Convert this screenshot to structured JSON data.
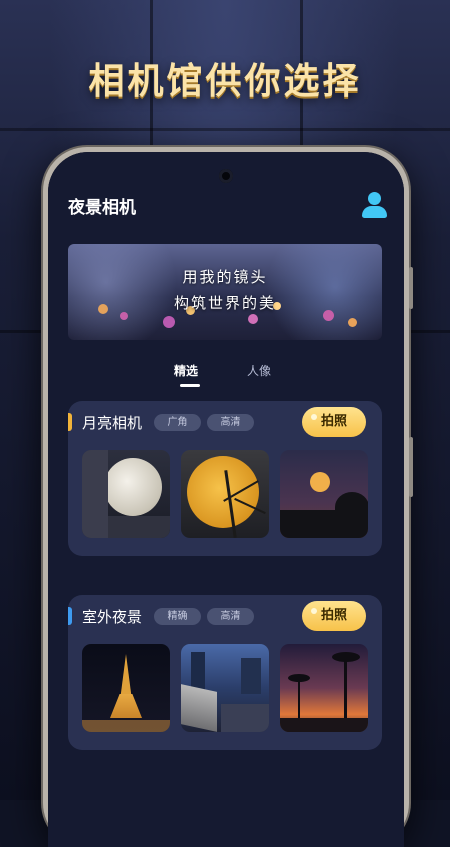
{
  "headline": "相机馆供你选择",
  "app": {
    "title": "夜景相机",
    "profile_icon": "user-profile-icon"
  },
  "banner": {
    "line1": "用我的镜头",
    "line2": "构筑世界的美"
  },
  "tabs": [
    {
      "label": "精选",
      "active": true
    },
    {
      "label": "人像",
      "active": false
    }
  ],
  "cards": [
    {
      "title": "月亮相机",
      "accent": "#f2b43a",
      "tags": [
        "广角",
        "高清"
      ],
      "action_label": "拍照",
      "thumbnails": [
        "moon-over-building",
        "full-moon-tree-silhouette",
        "moon-over-trees-dusk"
      ]
    },
    {
      "title": "室外夜景",
      "accent": "#3e9bf0",
      "tags": [
        "精确",
        "高清"
      ],
      "action_label": "拍照",
      "thumbnails": [
        "eiffel-tower-night",
        "city-train-station",
        "palm-trees-sunset"
      ]
    }
  ]
}
